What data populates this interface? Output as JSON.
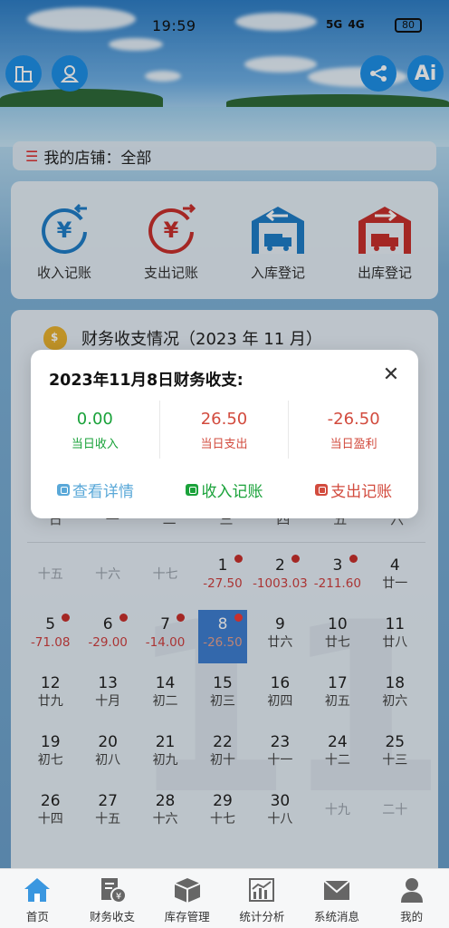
{
  "status_bar": {
    "time": "19:59",
    "signal_text": "5G  4G",
    "battery": "80"
  },
  "header": {
    "left_buttons": [
      "building-icon",
      "user-icon"
    ],
    "right_buttons": [
      "share-icon"
    ],
    "ai_label": "Ai"
  },
  "store": {
    "label": "我的店铺：全部"
  },
  "quick_actions": [
    {
      "label": "收入记账",
      "icon": "income-yen-icon",
      "color": "#1f7ec8"
    },
    {
      "label": "支出记账",
      "icon": "expense-yen-icon",
      "color": "#c8302d"
    },
    {
      "label": "入库登记",
      "icon": "warehouse-in-icon",
      "color": "#1f7ec8"
    },
    {
      "label": "出库登记",
      "icon": "warehouse-out-icon",
      "color": "#c8302d"
    }
  ],
  "finance": {
    "title": "财务收支情况（2023 年 11 月）",
    "watermark": "11",
    "weekdays": [
      "日",
      "一",
      "二",
      "三",
      "四",
      "五",
      "六"
    ],
    "days": [
      {
        "num": "",
        "lunar": "十五",
        "amt": "",
        "muted": true,
        "dot": false
      },
      {
        "num": "",
        "lunar": "十六",
        "amt": "",
        "muted": true,
        "dot": false
      },
      {
        "num": "",
        "lunar": "十七",
        "amt": "",
        "muted": true,
        "dot": false
      },
      {
        "num": "1",
        "lunar": "",
        "amt": "-27.50",
        "muted": false,
        "dot": true
      },
      {
        "num": "2",
        "lunar": "",
        "amt": "-1003.03",
        "muted": false,
        "dot": true
      },
      {
        "num": "3",
        "lunar": "",
        "amt": "-211.60",
        "muted": false,
        "dot": true
      },
      {
        "num": "4",
        "lunar": "廿一",
        "amt": "",
        "muted": false,
        "dot": false
      },
      {
        "num": "5",
        "lunar": "",
        "amt": "-71.08",
        "muted": false,
        "dot": true
      },
      {
        "num": "6",
        "lunar": "",
        "amt": "-29.00",
        "muted": false,
        "dot": true
      },
      {
        "num": "7",
        "lunar": "",
        "amt": "-14.00",
        "muted": false,
        "dot": true
      },
      {
        "num": "8",
        "lunar": "",
        "amt": "-26.50",
        "muted": false,
        "dot": true,
        "selected": true
      },
      {
        "num": "9",
        "lunar": "廿六",
        "amt": "",
        "muted": false,
        "dot": false
      },
      {
        "num": "10",
        "lunar": "廿七",
        "amt": "",
        "muted": false,
        "dot": false
      },
      {
        "num": "11",
        "lunar": "廿八",
        "amt": "",
        "muted": false,
        "dot": false
      },
      {
        "num": "12",
        "lunar": "廿九",
        "amt": "",
        "muted": false,
        "dot": false
      },
      {
        "num": "13",
        "lunar": "十月",
        "amt": "",
        "muted": false,
        "dot": false
      },
      {
        "num": "14",
        "lunar": "初二",
        "amt": "",
        "muted": false,
        "dot": false
      },
      {
        "num": "15",
        "lunar": "初三",
        "amt": "",
        "muted": false,
        "dot": false
      },
      {
        "num": "16",
        "lunar": "初四",
        "amt": "",
        "muted": false,
        "dot": false
      },
      {
        "num": "17",
        "lunar": "初五",
        "amt": "",
        "muted": false,
        "dot": false
      },
      {
        "num": "18",
        "lunar": "初六",
        "amt": "",
        "muted": false,
        "dot": false
      },
      {
        "num": "19",
        "lunar": "初七",
        "amt": "",
        "muted": false,
        "dot": false
      },
      {
        "num": "20",
        "lunar": "初八",
        "amt": "",
        "muted": false,
        "dot": false
      },
      {
        "num": "21",
        "lunar": "初九",
        "amt": "",
        "muted": false,
        "dot": false
      },
      {
        "num": "22",
        "lunar": "初十",
        "amt": "",
        "muted": false,
        "dot": false
      },
      {
        "num": "23",
        "lunar": "十一",
        "amt": "",
        "muted": false,
        "dot": false
      },
      {
        "num": "24",
        "lunar": "十二",
        "amt": "",
        "muted": false,
        "dot": false
      },
      {
        "num": "25",
        "lunar": "十三",
        "amt": "",
        "muted": false,
        "dot": false
      },
      {
        "num": "26",
        "lunar": "十四",
        "amt": "",
        "muted": false,
        "dot": false
      },
      {
        "num": "27",
        "lunar": "十五",
        "amt": "",
        "muted": false,
        "dot": false
      },
      {
        "num": "28",
        "lunar": "十六",
        "amt": "",
        "muted": false,
        "dot": false
      },
      {
        "num": "29",
        "lunar": "十七",
        "amt": "",
        "muted": false,
        "dot": false
      },
      {
        "num": "30",
        "lunar": "十八",
        "amt": "",
        "muted": false,
        "dot": false
      },
      {
        "num": "",
        "lunar": "十九",
        "amt": "",
        "muted": true,
        "dot": false
      },
      {
        "num": "",
        "lunar": "二十",
        "amt": "",
        "muted": true,
        "dot": false
      }
    ]
  },
  "popup": {
    "title": "2023年11月8日财务收支:",
    "stats": [
      {
        "value": "0.00",
        "label": "当日收入",
        "tone": "green"
      },
      {
        "value": "26.50",
        "label": "当日支出",
        "tone": "red"
      },
      {
        "value": "-26.50",
        "label": "当日盈利",
        "tone": "red"
      }
    ],
    "actions": [
      {
        "label": "查看详情",
        "tone": "blue",
        "icon": "details-icon"
      },
      {
        "label": "收入记账",
        "tone": "green",
        "icon": "add-income-icon"
      },
      {
        "label": "支出记账",
        "tone": "red",
        "icon": "add-expense-icon"
      }
    ]
  },
  "nav": [
    {
      "label": "首页",
      "icon": "home-icon",
      "active": true
    },
    {
      "label": "财务收支",
      "icon": "finance-icon",
      "active": false
    },
    {
      "label": "库存管理",
      "icon": "inventory-icon",
      "active": false
    },
    {
      "label": "统计分析",
      "icon": "statistics-icon",
      "active": false
    },
    {
      "label": "系统消息",
      "icon": "message-icon",
      "active": false
    },
    {
      "label": "我的",
      "icon": "profile-icon",
      "active": false
    }
  ]
}
